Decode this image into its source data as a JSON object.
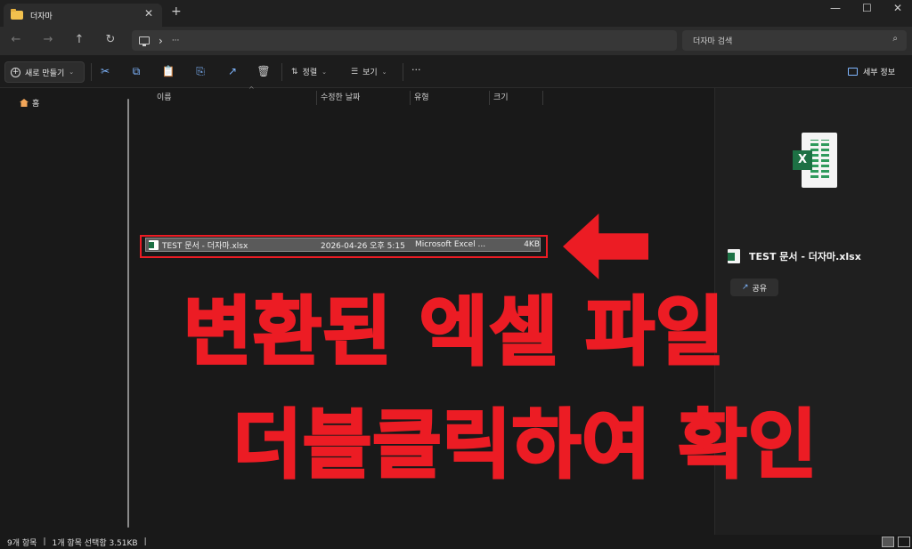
{
  "window": {
    "tab_title": "더자마",
    "tab_close": "✕",
    "new_tab": "+",
    "minimize": "—",
    "maximize": "☐",
    "close": "✕"
  },
  "address_bar": {
    "back": "←",
    "forward": "→",
    "up": "↑",
    "refresh": "↻",
    "chevron": "›",
    "ellipsis": "···",
    "search_placeholder": "더자마 검색"
  },
  "toolbar": {
    "new_label": "새로 만들기",
    "sort_label": "정렬",
    "view_label": "보기",
    "more": "···",
    "details_label": "세부 정보"
  },
  "nav": {
    "home_label": "홈"
  },
  "columns": [
    "이름",
    "수정한 날짜",
    "유형",
    "크기"
  ],
  "files": [
    {
      "name": "TEST 문서 - 더자마.xlsx",
      "modified": "2026-04-26 오후 5:15",
      "type": "Microsoft Excel ...",
      "size": "4KB",
      "selected": true
    }
  ],
  "details": {
    "file_title": "TEST 문서 - 더자마.xlsx",
    "share_label": "공유",
    "icon_letter": "X"
  },
  "status": {
    "item_count": "9개 항목",
    "selection": "1개 항목 선택함 3.51KB"
  },
  "overlay": {
    "line1": "변환된 엑셀 파일",
    "line2": "더블클릭하여 확인",
    "color": "#ec1c24"
  }
}
